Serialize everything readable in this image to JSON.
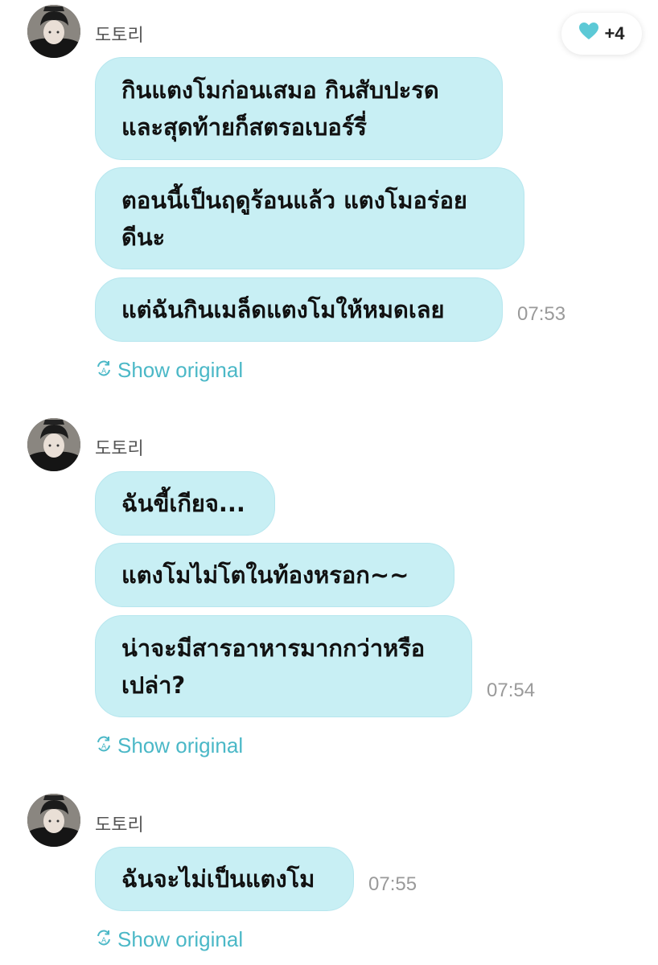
{
  "reaction": {
    "icon": "heart-icon",
    "color": "#5cc9d6",
    "count": "+4"
  },
  "groups": [
    {
      "sender": "도토리",
      "messages": [
        "กินแตงโมก่อนเสมอ กินสับปะรด\nและสุดท้ายก็สตรอเบอร์รี่",
        "ตอนนี้เป็นฤดูร้อนแล้ว แตงโมอร่อย\nดีนะ",
        "แต่ฉันกินเมล็ดแตงโมให้หมดเลย"
      ],
      "time": "07:53",
      "show_original": "Show original"
    },
    {
      "sender": "도토리",
      "messages": [
        "ฉันขี้เกียจ...",
        "แตงโมไม่โตในท้องหรอก~~",
        "น่าจะมีสารอาหารมากกว่าหรือ\nเปล่า?"
      ],
      "time": "07:54",
      "show_original": "Show original"
    },
    {
      "sender": "도토리",
      "messages": [
        "ฉันจะไม่เป็นแตงโม"
      ],
      "time": "07:55",
      "show_original": "Show original"
    }
  ],
  "colors": {
    "bubble": "#c8eff4",
    "accent": "#4bb8c7",
    "time": "#9a9a9a"
  }
}
